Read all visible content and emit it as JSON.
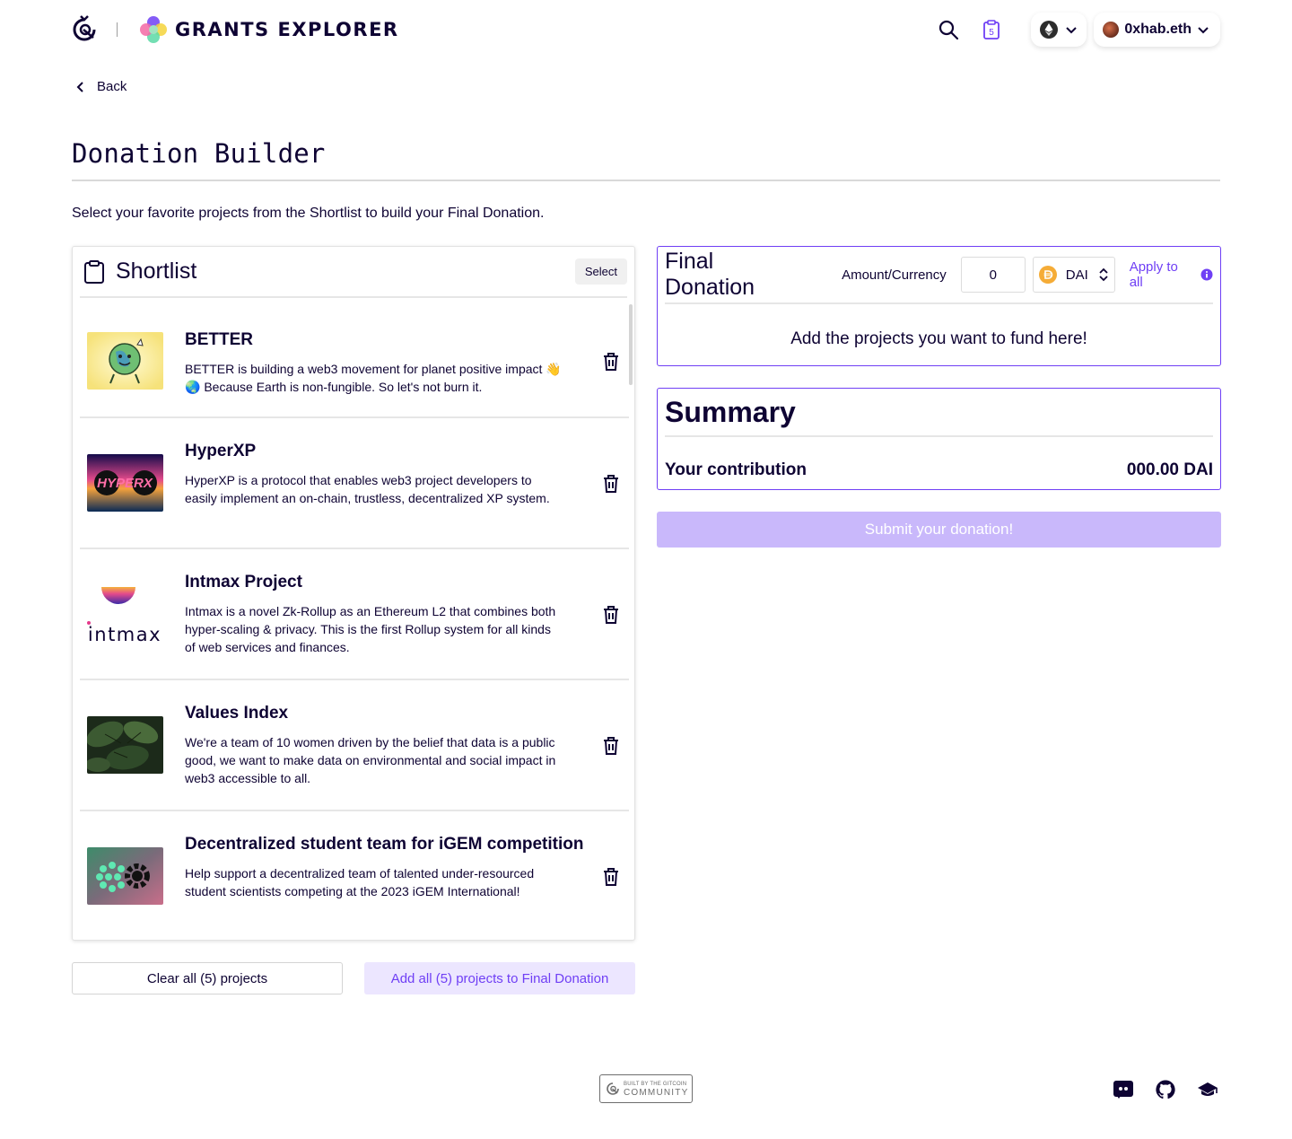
{
  "header": {
    "brand_title": "GRANTS EXPLORER",
    "account_name": "0xhab.eth",
    "cart_count": "5",
    "icons": [
      "gitcoin-logo",
      "grants-flower-logo",
      "search-icon",
      "clipboard-cart-icon",
      "ethereum-icon",
      "chevron-down-icon"
    ]
  },
  "back_label": "Back",
  "page_title": "Donation Builder",
  "subtitle": "Select your favorite projects from the Shortlist to build your Final Donation.",
  "shortlist": {
    "title": "Shortlist",
    "select_label": "Select",
    "projects": [
      {
        "name": "BETTER",
        "description": "BETTER is building a web3 movement for planet positive impact 👋🌏 Because Earth is non-fungible. So let's not burn it."
      },
      {
        "name": "HyperXP",
        "description": "HyperXP is a protocol that enables web3 project developers to easily implement an on-chain, trustless, decentralized XP system.",
        "logo_text": "HYPERX"
      },
      {
        "name": "Intmax Project",
        "description": "Intmax is a novel Zk-Rollup as an Ethereum L2 that combines both hyper-scaling & privacy. This is the first Rollup system for all kinds of web services and finances.",
        "logo_text": "intmax"
      },
      {
        "name": "Values Index",
        "description": "We're a team of 10 women driven by the belief that data is a public good, we want to make data on environmental and social impact in web3 accessible to all."
      },
      {
        "name": "Decentralized student team for iGEM competition",
        "description": "Help support a decentralized team of talented under-resourced student scientists competing at the 2023 iGEM International!"
      }
    ]
  },
  "buttons": {
    "clear_all": "Clear all (5) projects",
    "add_all": "Add all (5) projects to Final Donation",
    "submit": "Submit your donation!"
  },
  "final_donation": {
    "title": "Final Donation",
    "amount_label": "Amount/Currency",
    "amount_value": "0",
    "currency": "DAI",
    "apply_label": "Apply to all",
    "empty_message": "Add the projects you want to fund here!"
  },
  "summary": {
    "title": "Summary",
    "contribution_label": "Your contribution",
    "contribution_value": "000.00 DAI"
  },
  "footer": {
    "badge_small": "BUILT BY THE GITCOIN",
    "badge_big": "COMMUNITY",
    "icons": [
      "discord-icon",
      "github-icon",
      "docs-icon"
    ]
  },
  "colors": {
    "accent": "#6f3ff5",
    "text": "#0e0333",
    "submit_disabled": "#c9b8fb",
    "add_all_bg": "#ece6ff"
  }
}
